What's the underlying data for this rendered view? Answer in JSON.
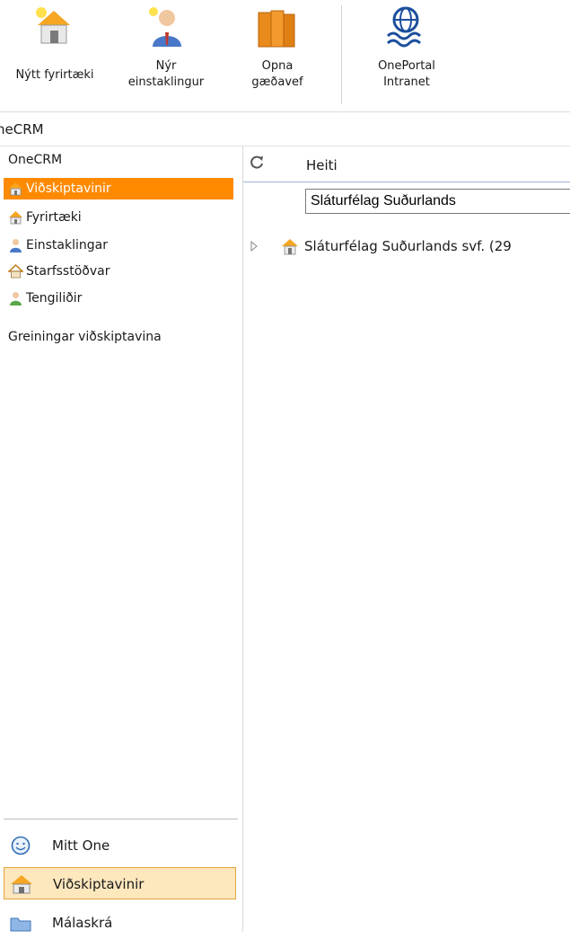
{
  "ribbon": {
    "buttons": [
      {
        "label": "Nýtt fyrirtæki",
        "icon": "new-company-icon"
      },
      {
        "label": "Nýr\neinstaklingur",
        "icon": "new-person-icon"
      },
      {
        "label": "Opna\ngæðavef",
        "icon": "books-icon"
      },
      {
        "label": "OnePortal\nIntranet",
        "icon": "globe-waves-icon"
      }
    ]
  },
  "app": {
    "title": "neCRM"
  },
  "nav": {
    "root": "OneCRM",
    "items": [
      {
        "label": "Viðskiptavinir",
        "icon": "house-icon",
        "active": true
      },
      {
        "label": "Fyrirtæki",
        "icon": "house-icon",
        "active": false
      },
      {
        "label": "Einstaklingar",
        "icon": "person-icon",
        "active": false
      },
      {
        "label": "Starfsstöðvar",
        "icon": "small-house-icon",
        "active": false
      },
      {
        "label": "Tengiliðir",
        "icon": "contact-person-icon",
        "active": false
      }
    ],
    "section": "Greiningar viðskiptavina",
    "bottom": [
      {
        "label": "Mitt One",
        "icon": "smiley-icon",
        "selected": false
      },
      {
        "label": "Viðskiptavinir",
        "icon": "house-icon",
        "selected": true
      },
      {
        "label": "Málaskrá",
        "icon": "folder-icon",
        "selected": false
      }
    ]
  },
  "grid": {
    "column_header": "Heiti",
    "filter_value": "Sláturfélag Suðurlands",
    "rows": [
      {
        "label": "Sláturfélag Suðurlands svf. (29"
      }
    ]
  },
  "colors": {
    "accent": "#ff8a00",
    "selected_bg": "#fde7bd",
    "selected_border": "#e6a43a"
  }
}
